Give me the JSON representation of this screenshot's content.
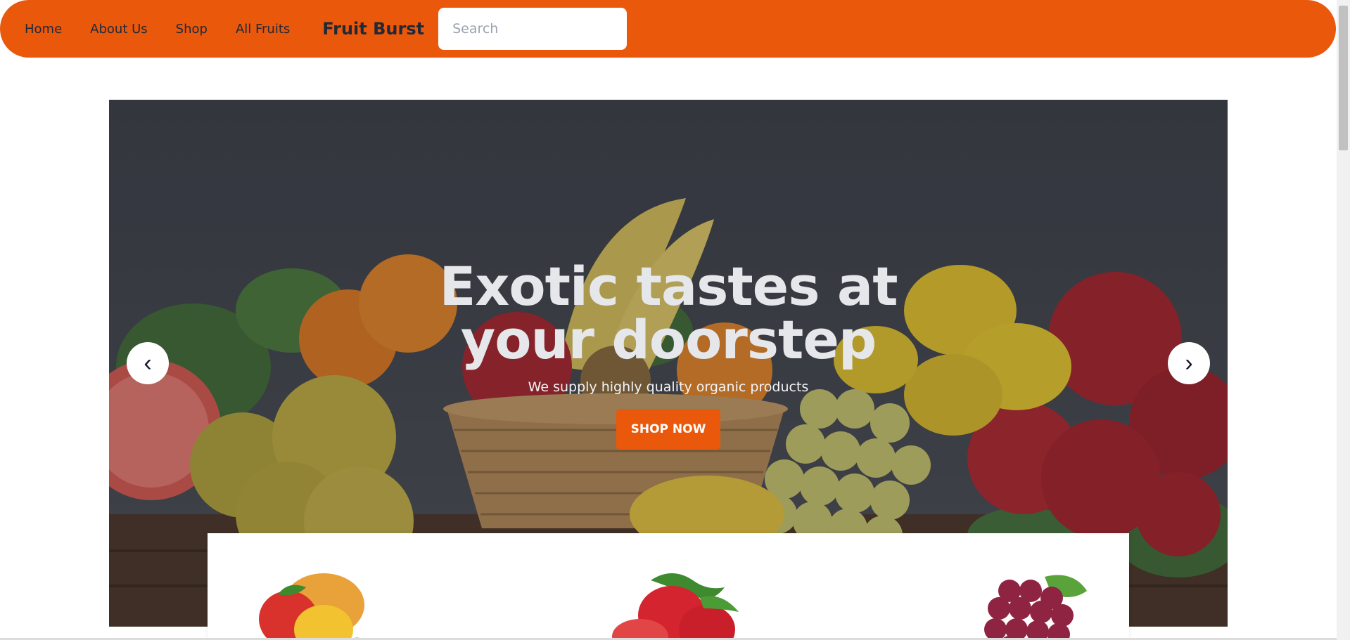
{
  "nav": {
    "links": [
      "Home",
      "About Us",
      "Shop",
      "All Fruits"
    ],
    "brand": "Fruit Burst",
    "search_placeholder": "Search"
  },
  "hero": {
    "title": "Exotic tastes at your doorstep",
    "subtitle": "We supply highly quality organic products",
    "cta_label": "SHOP NOW",
    "prev_icon": "‹",
    "next_icon": "›"
  },
  "products": {
    "items": [
      "mango-icon",
      "strawberry-icon",
      "grapes-icon"
    ]
  },
  "colors": {
    "accent": "#ea580c",
    "dark_text": "#1f2937",
    "hero_bg": "#3f434a"
  }
}
